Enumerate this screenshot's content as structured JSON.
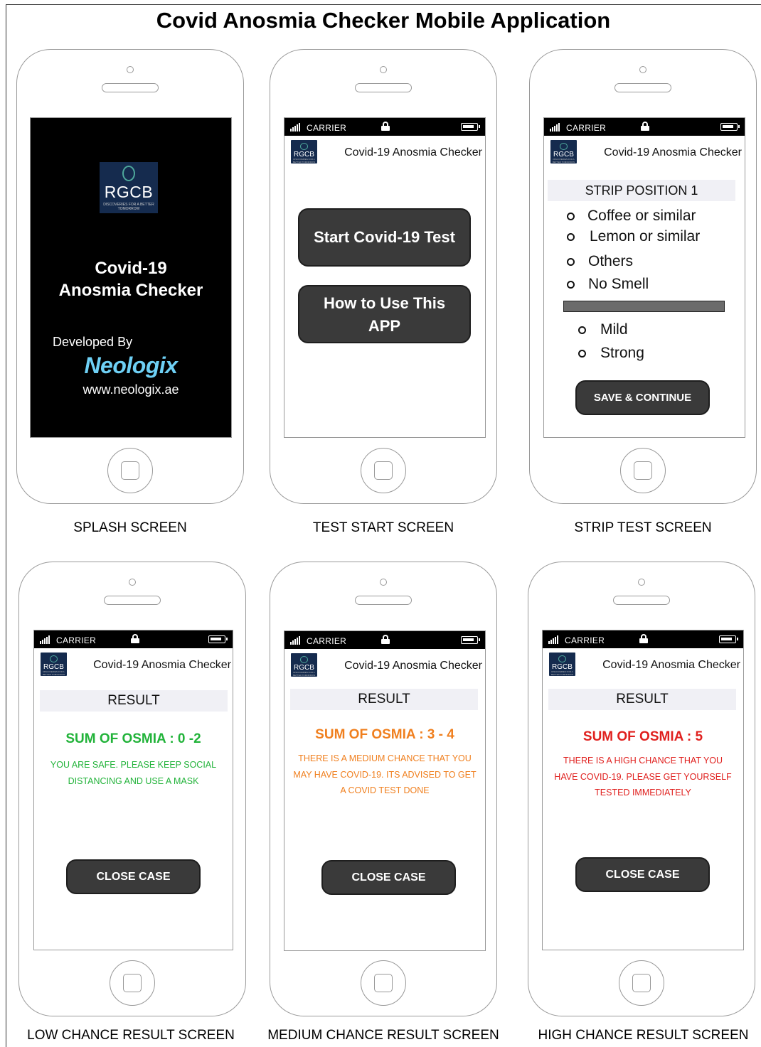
{
  "page": {
    "title": "Covid Anosmia Checker Mobile Application"
  },
  "status_bar": {
    "carrier": "CARRIER"
  },
  "app": {
    "header_title": "Covid-19 Anosmia Checker",
    "logo_text": "RGCB",
    "logo_tagline": "DISCOVERIES FOR A BETTER TOMORROW"
  },
  "splash": {
    "label": "SPLASH SCREEN",
    "title_line1": "Covid-19",
    "title_line2": "Anosmia Checker",
    "developed_by": "Developed By",
    "brand": "Neologix",
    "url": "www.neologix.ae"
  },
  "test_start": {
    "label": "TEST START SCREEN",
    "start_button": "Start Covid-19 Test",
    "howto_line1": "How to Use This",
    "howto_line2": "APP"
  },
  "strip_test": {
    "label": "STRIP TEST SCREEN",
    "position_label": "STRIP POSITION 1",
    "smell_options": [
      "Coffee or similar",
      "Lemon or similar",
      "Others",
      "No Smell"
    ],
    "intensity_options": [
      "Mild",
      "Strong"
    ],
    "save_button": "SAVE & CONTINUE"
  },
  "results": {
    "heading": "RESULT",
    "close_button": "CLOSE CASE",
    "low": {
      "label": "LOW CHANCE RESULT SCREEN",
      "sum": "SUM OF OSMIA : 0 -2",
      "line1": "YOU ARE SAFE. PLEASE KEEP SOCIAL",
      "line2": "DISTANCING AND USE A MASK",
      "color": "#22b33a"
    },
    "medium": {
      "label": "MEDIUM CHANCE RESULT SCREEN",
      "sum": "SUM OF OSMIA : 3 - 4",
      "line1": "THERE IS A MEDIUM CHANCE  THAT YOU",
      "line2": "MAY HAVE COVID-19.  ITS ADVISED TO GET",
      "line3": "A COVID TEST DONE",
      "color": "#f07f1e"
    },
    "high": {
      "label": "HIGH CHANCE RESULT SCREEN",
      "sum": "SUM OF OSMIA : 5",
      "line1": "THERE IS A HIGH CHANCE THAT YOU",
      "line2": "HAVE COVID-19.  PLEASE GET YOURSELF",
      "line3": "TESTED IMMEDIATELY",
      "color": "#e0201e"
    }
  }
}
